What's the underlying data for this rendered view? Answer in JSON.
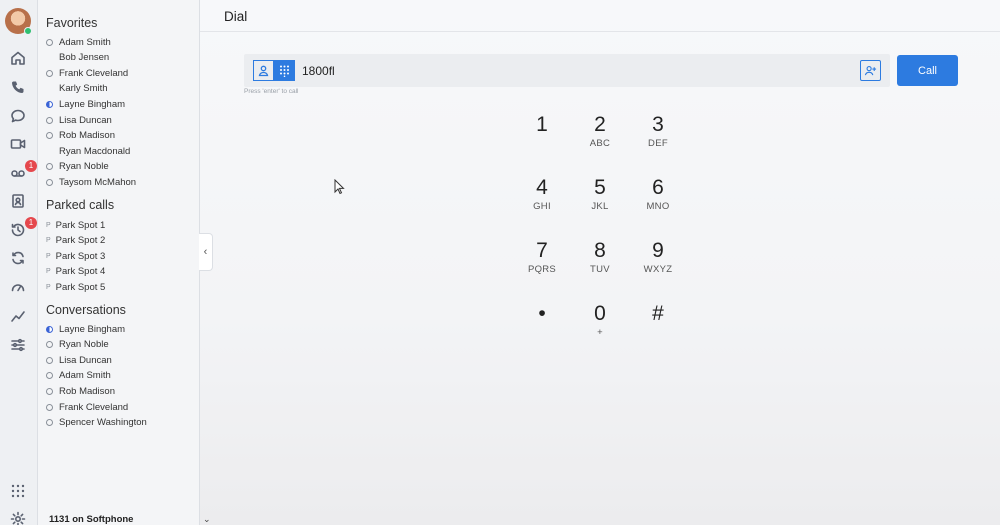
{
  "rail": {
    "badges": [
      "1",
      "1"
    ]
  },
  "sidebar": {
    "favorites_title": "Favorites",
    "favorites": [
      {
        "name": "Adam Smith",
        "status": "ring"
      },
      {
        "name": "Bob Jensen",
        "status": "none"
      },
      {
        "name": "Frank Cleveland",
        "status": "ring"
      },
      {
        "name": "Karly Smith",
        "status": "none"
      },
      {
        "name": "Layne Bingham",
        "status": "half"
      },
      {
        "name": "Lisa Duncan",
        "status": "ring"
      },
      {
        "name": "Rob Madison",
        "status": "ring"
      },
      {
        "name": "Ryan Macdonald",
        "status": "none"
      },
      {
        "name": "Ryan Noble",
        "status": "ring"
      },
      {
        "name": "Taysom McMahon",
        "status": "ring"
      }
    ],
    "parked_title": "Parked calls",
    "parked": [
      {
        "name": "Park Spot 1",
        "marker": "P"
      },
      {
        "name": "Park Spot 2",
        "marker": "P"
      },
      {
        "name": "Park Spot 3",
        "marker": "P"
      },
      {
        "name": "Park Spot 4",
        "marker": "P"
      },
      {
        "name": "Park Spot 5",
        "marker": "P"
      }
    ],
    "conversations_title": "Conversations",
    "conversations": [
      {
        "name": "Layne Bingham",
        "status": "half"
      },
      {
        "name": "Ryan Noble",
        "status": "ring"
      },
      {
        "name": "Lisa Duncan",
        "status": "ring"
      },
      {
        "name": "Adam Smith",
        "status": "ring"
      },
      {
        "name": "Rob Madison",
        "status": "ring"
      },
      {
        "name": "Frank Cleveland",
        "status": "ring"
      },
      {
        "name": "Spencer Washington",
        "status": "ring"
      }
    ],
    "footer": "1131 on Softphone"
  },
  "main": {
    "title": "Dial",
    "dial_value": "1800fl",
    "hint": "Press 'enter' to call",
    "call_label": "Call",
    "keypad": [
      {
        "digit": "1",
        "letters": ""
      },
      {
        "digit": "2",
        "letters": "ABC"
      },
      {
        "digit": "3",
        "letters": "DEF"
      },
      {
        "digit": "4",
        "letters": "GHI"
      },
      {
        "digit": "5",
        "letters": "JKL"
      },
      {
        "digit": "6",
        "letters": "MNO"
      },
      {
        "digit": "7",
        "letters": "PQRS"
      },
      {
        "digit": "8",
        "letters": "TUV"
      },
      {
        "digit": "9",
        "letters": "WXYZ"
      },
      {
        "digit": "•",
        "letters": ""
      },
      {
        "digit": "0",
        "letters": "+"
      },
      {
        "digit": "#",
        "letters": ""
      }
    ]
  },
  "colors": {
    "accent": "#2d7be0",
    "badge": "#e5484d",
    "online": "#2fbf71"
  }
}
